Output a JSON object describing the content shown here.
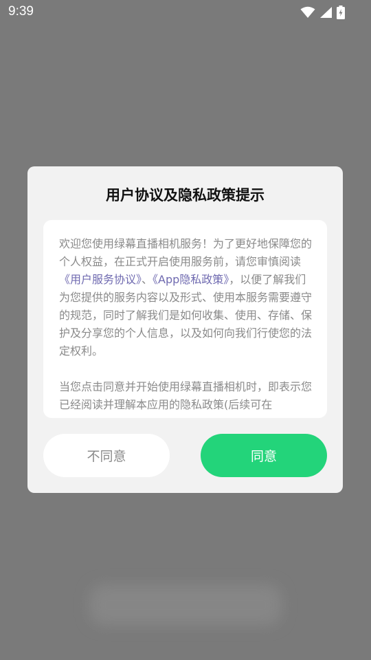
{
  "status_bar": {
    "time": "9:39",
    "icons": [
      "wifi-icon",
      "cellular-signal-icon",
      "battery-charging-icon"
    ]
  },
  "dialog": {
    "title": "用户协议及隐私政策提示",
    "paragraph1": {
      "part1": "欢迎您使用绿幕直播相机服务！为了更好地保障您的个人权益，在正式开启使用服务前，请您审慎阅读",
      "link1": "《用户服务协议》",
      "sep": "、",
      "link2": "《App隐私政策》",
      "part2": "，以便了解我们为您提供的服务内容以及形式、使用本服务需要遵守的规范，同时了解我们是如何收集、使用、存储、保护及分享您的个人信息，以及如何向我们行使您的法定权利。"
    },
    "paragraph2": "当您点击同意并开始使用绿幕直播相机时，即表示您已经阅读并理解本应用的隐私政策(后续可在",
    "disagree_label": "不同意",
    "agree_label": "同意"
  },
  "colors": {
    "accent_green": "#23d47a",
    "link_purple": "#6f6ab0",
    "overlay_gray": "#7a7a7a"
  }
}
